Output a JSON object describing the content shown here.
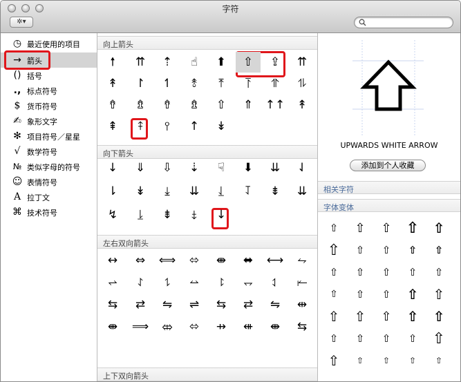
{
  "window": {
    "title": "字符",
    "action_label": "✲▾",
    "search_placeholder": ""
  },
  "sidebar": {
    "items": [
      {
        "icon": "◷",
        "label": "最近使用的项目"
      },
      {
        "icon": "→",
        "label": "箭头"
      },
      {
        "icon": "()",
        "label": "括号"
      },
      {
        "icon": ".,",
        "label": "标点符号"
      },
      {
        "icon": "$",
        "label": "货币符号"
      },
      {
        "icon": "✍",
        "label": "象形文字"
      },
      {
        "icon": "✻",
        "label": "项目符号／星星"
      },
      {
        "icon": "√",
        "label": "数学符号"
      },
      {
        "icon": "№",
        "label": "类似字母的符号"
      },
      {
        "icon": "☺",
        "label": "表情符号"
      },
      {
        "icon": "A",
        "label": "拉丁文"
      },
      {
        "icon": "⌘",
        "label": "技术符号"
      }
    ],
    "selected_index": 1
  },
  "sections": [
    {
      "title": "向上箭头",
      "glyphs": [
        "🠕",
        "⇈",
        "⇡",
        "☝",
        "⬆",
        "⇧",
        "⇪",
        "⇈",
        "↟",
        "↾",
        "↿",
        "⥉",
        "⤒",
        "⥔",
        "⥣",
        "⥮",
        "⇮",
        "⇯",
        "⇮",
        "⇯",
        "⇧",
        "⇑",
        "↑↑",
        "↟",
        "⇞",
        "⤉",
        "⫯",
        "↑",
        "↡"
      ]
    },
    {
      "title": "向下箭头",
      "glyphs": [
        "↓",
        "⇓",
        "⇩",
        "⇣",
        "☟",
        "⬇",
        "⇊",
        "⇃",
        "⇂",
        "↡",
        "⤓",
        "⇊",
        "⥙",
        "⥡",
        "⇟",
        "⇊",
        "↯",
        "⥕",
        "⇟",
        "⤈",
        "↓"
      ]
    },
    {
      "title": "左右双向箭头",
      "glyphs": [
        "↔",
        "⇔",
        "⟺",
        "⬄",
        "⇼",
        "⬌",
        "⟷",
        "⥊",
        "⥋",
        "⥌",
        "⥍",
        "⥎",
        "⥏",
        "⥐",
        "⥑",
        "⥒",
        "⇆",
        "⇄",
        "⇋",
        "⇌",
        "⇆",
        "⇄",
        "⇋",
        "⇹",
        "⇼",
        "⟹",
        "⤄",
        "⬄",
        "⇸",
        "⇺",
        "⇼",
        "⇆"
      ]
    },
    {
      "title": "上下双向箭头",
      "glyphs": []
    }
  ],
  "detail": {
    "glyph": "⇧",
    "name": "UPWARDS WHITE ARROW",
    "favorites_button": "添加到个人收藏",
    "related_heading": "相关字符",
    "variants_heading": "字体变体",
    "variants": [
      "⇧",
      "⇧",
      "⇧",
      "⇧",
      "⇧",
      "⇧",
      "⇧",
      "⇧",
      "⇧",
      "⇧",
      "⇧",
      "⇧",
      "⇧",
      "⇧",
      "⇧",
      "⇧",
      "⇧",
      "⇧",
      "⇧",
      "⇧",
      "⇧",
      "⇧",
      "⇧",
      "⇧",
      "⇧",
      "⇧",
      "⇧",
      "⇧",
      "⇧",
      "⇧",
      "⇧",
      "⇧",
      "⇧",
      "⇧",
      "⇧"
    ]
  }
}
